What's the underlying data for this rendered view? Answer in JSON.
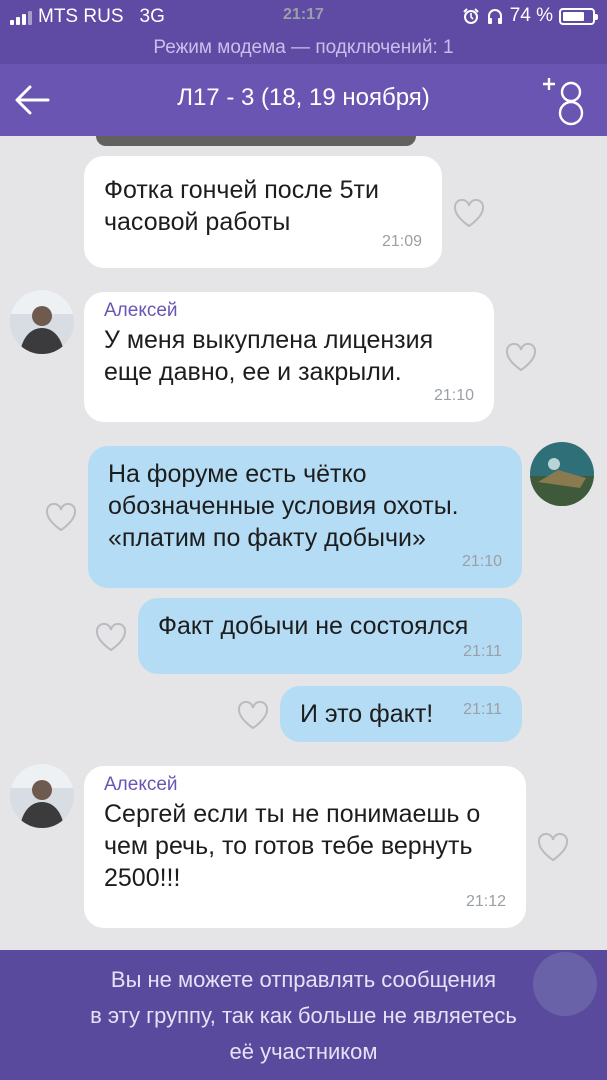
{
  "status_bar": {
    "carrier": "MTS RUS",
    "network": "3G",
    "time": "21:17",
    "battery": "74 %",
    "battery_level": 0.74
  },
  "hotspot_banner": "Режим модема — подключений: 1",
  "header": {
    "title": "Л17 - 3 (18, 19 ноября)"
  },
  "messages": [
    {
      "direction": "in",
      "sender": "",
      "text": "Фотка гончей после 5ти часовой работы",
      "time": "21:09"
    },
    {
      "direction": "in",
      "sender": "Алексей",
      "text": "У меня выкуплена лицензия еще давно, ее и закрыли.",
      "time": "21:10"
    },
    {
      "direction": "out",
      "sender": "",
      "text": "На форуме есть чётко обозначенные условия охоты. «платим по факту добычи»",
      "time": "21:10"
    },
    {
      "direction": "out",
      "sender": "",
      "text": "Факт добычи не состоялся",
      "time": "21:11"
    },
    {
      "direction": "out",
      "sender": "",
      "text": "И это факт!",
      "time": "21:11"
    },
    {
      "direction": "in",
      "sender": "Алексей",
      "text": "Сергей если ты не понимаешь о чем речь, то готов тебе вернуть 2500!!!",
      "time": "21:12"
    }
  ],
  "footer": {
    "line1": "Вы не можете отправлять сообщения",
    "line2": "в эту группу, так как больше не являетесь",
    "line3": "её участником"
  },
  "colors": {
    "header": "#6a55b3",
    "incoming": "#ffffff",
    "outgoing": "#b5dcf5",
    "sender": "#6a55b3"
  }
}
